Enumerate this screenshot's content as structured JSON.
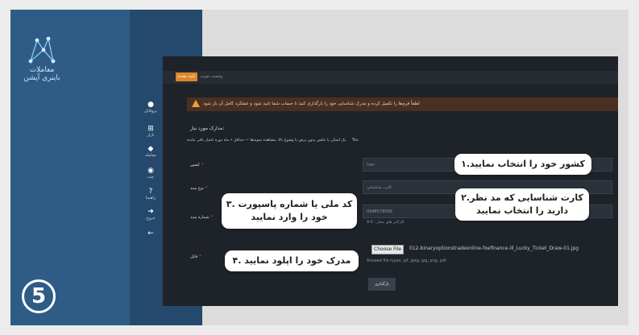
{
  "brand": {
    "logo_line1": "معاملات",
    "logo_line2": "باینری آپشن",
    "step_number": "⑤"
  },
  "sidebar": {
    "items": [
      {
        "icon": "person-icon",
        "glyph": "👤",
        "label": "پروفایل"
      },
      {
        "icon": "cart-icon",
        "glyph": "🛒",
        "label": "بازار"
      },
      {
        "icon": "diamond-icon",
        "glyph": "◆",
        "label": "معامله"
      },
      {
        "icon": "chat-icon",
        "glyph": "💬",
        "label": "چت"
      },
      {
        "icon": "help-icon",
        "glyph": "❓",
        "label": "راهنما"
      },
      {
        "icon": "logout-icon",
        "glyph": "➜",
        "label": "خروج"
      },
      {
        "icon": "back-icon",
        "glyph": "←",
        "label": ""
      }
    ]
  },
  "topbar": {
    "status_chip": "تایید نشده",
    "status_text": "وضعیت هویت"
  },
  "warning": {
    "text": "لطفاً فرم‌ها را تکمیل کرده و مدرک شناسایی خود را بارگذاری کنید تا حساب شما تایید شود و عملکرد کامل آن باز شود"
  },
  "form": {
    "title": "مدارک مورد نیاز:",
    "note": "یک اسکن یا عکس بدون برش با وضوح بالا، مشاهده نمونه‌ها — حداقل ۶ ماه دوره اعتبار باقی مانده",
    "note_tag": "%s,",
    "country_label": "کشور",
    "country_value": "Iran",
    "doc_type_label": "نوع سند",
    "doc_type_value": "کارت شناسایی",
    "doc_number_label": "شماره سند",
    "doc_number_value": "0948578569",
    "doc_number_hint": "9-0 : کاراکتر های مجاز",
    "file_label": "فایل",
    "file_button": "Choose File",
    "file_name": "012-binaryoptionstradeonline-fxefinance-ill_Lucky_Ticket_Draw-01.jpg",
    "file_hint": "Allowed file types: gif, jpeg, jpg, png, pdf",
    "upload_button": "بارگذاری"
  },
  "callouts": {
    "step1": "۱.کشور خود را انتخاب نمایید",
    "step2_line1": "۲.کارت شناسایی که مد نظر",
    "step2_line2": "دارید را انتخاب نمایید",
    "step3_line1": "۳. کد ملی یا شماره پاسپورت",
    "step3_line2": "خود را وارد نمایید",
    "step4": "۴. مدرک خود را اپلود نمایید"
  },
  "colors": {
    "panel": "#2e5c86",
    "screen": "#1e232a",
    "accent": "#e0862d",
    "required": "#e45151"
  }
}
